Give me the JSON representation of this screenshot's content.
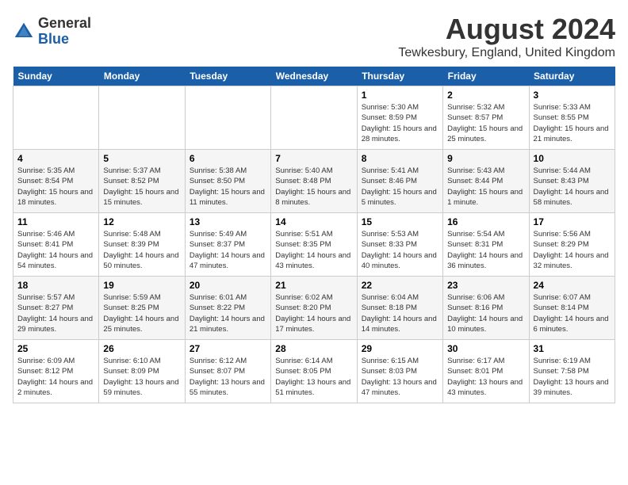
{
  "header": {
    "logo_general": "General",
    "logo_blue": "Blue",
    "month_year": "August 2024",
    "location": "Tewkesbury, England, United Kingdom"
  },
  "days_of_week": [
    "Sunday",
    "Monday",
    "Tuesday",
    "Wednesday",
    "Thursday",
    "Friday",
    "Saturday"
  ],
  "weeks": [
    [
      {
        "date": "",
        "info": ""
      },
      {
        "date": "",
        "info": ""
      },
      {
        "date": "",
        "info": ""
      },
      {
        "date": "",
        "info": ""
      },
      {
        "date": "1",
        "info": "Sunrise: 5:30 AM\nSunset: 8:59 PM\nDaylight: 15 hours\nand 28 minutes."
      },
      {
        "date": "2",
        "info": "Sunrise: 5:32 AM\nSunset: 8:57 PM\nDaylight: 15 hours\nand 25 minutes."
      },
      {
        "date": "3",
        "info": "Sunrise: 5:33 AM\nSunset: 8:55 PM\nDaylight: 15 hours\nand 21 minutes."
      }
    ],
    [
      {
        "date": "4",
        "info": "Sunrise: 5:35 AM\nSunset: 8:54 PM\nDaylight: 15 hours\nand 18 minutes."
      },
      {
        "date": "5",
        "info": "Sunrise: 5:37 AM\nSunset: 8:52 PM\nDaylight: 15 hours\nand 15 minutes."
      },
      {
        "date": "6",
        "info": "Sunrise: 5:38 AM\nSunset: 8:50 PM\nDaylight: 15 hours\nand 11 minutes."
      },
      {
        "date": "7",
        "info": "Sunrise: 5:40 AM\nSunset: 8:48 PM\nDaylight: 15 hours\nand 8 minutes."
      },
      {
        "date": "8",
        "info": "Sunrise: 5:41 AM\nSunset: 8:46 PM\nDaylight: 15 hours\nand 5 minutes."
      },
      {
        "date": "9",
        "info": "Sunrise: 5:43 AM\nSunset: 8:44 PM\nDaylight: 15 hours\nand 1 minute."
      },
      {
        "date": "10",
        "info": "Sunrise: 5:44 AM\nSunset: 8:43 PM\nDaylight: 14 hours\nand 58 minutes."
      }
    ],
    [
      {
        "date": "11",
        "info": "Sunrise: 5:46 AM\nSunset: 8:41 PM\nDaylight: 14 hours\nand 54 minutes."
      },
      {
        "date": "12",
        "info": "Sunrise: 5:48 AM\nSunset: 8:39 PM\nDaylight: 14 hours\nand 50 minutes."
      },
      {
        "date": "13",
        "info": "Sunrise: 5:49 AM\nSunset: 8:37 PM\nDaylight: 14 hours\nand 47 minutes."
      },
      {
        "date": "14",
        "info": "Sunrise: 5:51 AM\nSunset: 8:35 PM\nDaylight: 14 hours\nand 43 minutes."
      },
      {
        "date": "15",
        "info": "Sunrise: 5:53 AM\nSunset: 8:33 PM\nDaylight: 14 hours\nand 40 minutes."
      },
      {
        "date": "16",
        "info": "Sunrise: 5:54 AM\nSunset: 8:31 PM\nDaylight: 14 hours\nand 36 minutes."
      },
      {
        "date": "17",
        "info": "Sunrise: 5:56 AM\nSunset: 8:29 PM\nDaylight: 14 hours\nand 32 minutes."
      }
    ],
    [
      {
        "date": "18",
        "info": "Sunrise: 5:57 AM\nSunset: 8:27 PM\nDaylight: 14 hours\nand 29 minutes."
      },
      {
        "date": "19",
        "info": "Sunrise: 5:59 AM\nSunset: 8:25 PM\nDaylight: 14 hours\nand 25 minutes."
      },
      {
        "date": "20",
        "info": "Sunrise: 6:01 AM\nSunset: 8:22 PM\nDaylight: 14 hours\nand 21 minutes."
      },
      {
        "date": "21",
        "info": "Sunrise: 6:02 AM\nSunset: 8:20 PM\nDaylight: 14 hours\nand 17 minutes."
      },
      {
        "date": "22",
        "info": "Sunrise: 6:04 AM\nSunset: 8:18 PM\nDaylight: 14 hours\nand 14 minutes."
      },
      {
        "date": "23",
        "info": "Sunrise: 6:06 AM\nSunset: 8:16 PM\nDaylight: 14 hours\nand 10 minutes."
      },
      {
        "date": "24",
        "info": "Sunrise: 6:07 AM\nSunset: 8:14 PM\nDaylight: 14 hours\nand 6 minutes."
      }
    ],
    [
      {
        "date": "25",
        "info": "Sunrise: 6:09 AM\nSunset: 8:12 PM\nDaylight: 14 hours\nand 2 minutes."
      },
      {
        "date": "26",
        "info": "Sunrise: 6:10 AM\nSunset: 8:09 PM\nDaylight: 13 hours\nand 59 minutes."
      },
      {
        "date": "27",
        "info": "Sunrise: 6:12 AM\nSunset: 8:07 PM\nDaylight: 13 hours\nand 55 minutes."
      },
      {
        "date": "28",
        "info": "Sunrise: 6:14 AM\nSunset: 8:05 PM\nDaylight: 13 hours\nand 51 minutes."
      },
      {
        "date": "29",
        "info": "Sunrise: 6:15 AM\nSunset: 8:03 PM\nDaylight: 13 hours\nand 47 minutes."
      },
      {
        "date": "30",
        "info": "Sunrise: 6:17 AM\nSunset: 8:01 PM\nDaylight: 13 hours\nand 43 minutes."
      },
      {
        "date": "31",
        "info": "Sunrise: 6:19 AM\nSunset: 7:58 PM\nDaylight: 13 hours\nand 39 minutes."
      }
    ]
  ]
}
